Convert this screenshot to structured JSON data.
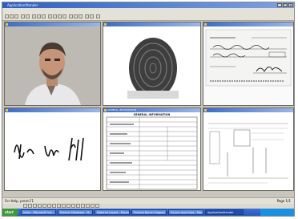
{
  "window": {
    "title": "ApplicationXtender"
  },
  "menu": [
    "File",
    "Edit",
    "View",
    "Document",
    "Page",
    "Tools",
    "Annotate",
    "Utilities",
    "Window",
    "Help"
  ],
  "panes": [
    {
      "title": "",
      "content": "portrait photo"
    },
    {
      "title": "",
      "content": "fingerprint"
    },
    {
      "title": "",
      "content": "check"
    },
    {
      "title": "",
      "content": "signature"
    },
    {
      "title": "GENERAL INFORMATION",
      "content": "form"
    },
    {
      "title": "",
      "content": "form"
    }
  ],
  "form": {
    "heading": "GENERAL INFORMATION"
  },
  "status": {
    "left": "For Help, press F1",
    "right": "Page 1/1"
  },
  "taskbar": {
    "start": "start",
    "tasks": [
      "Inbox - Microsoft Out...",
      "Product Database - M...",
      "Material Layout - Microsoft",
      "Finance Bench Support - M...",
      "Go-to's and Links - Microsoft",
      "ApplicationXtender"
    ],
    "clock": ""
  }
}
